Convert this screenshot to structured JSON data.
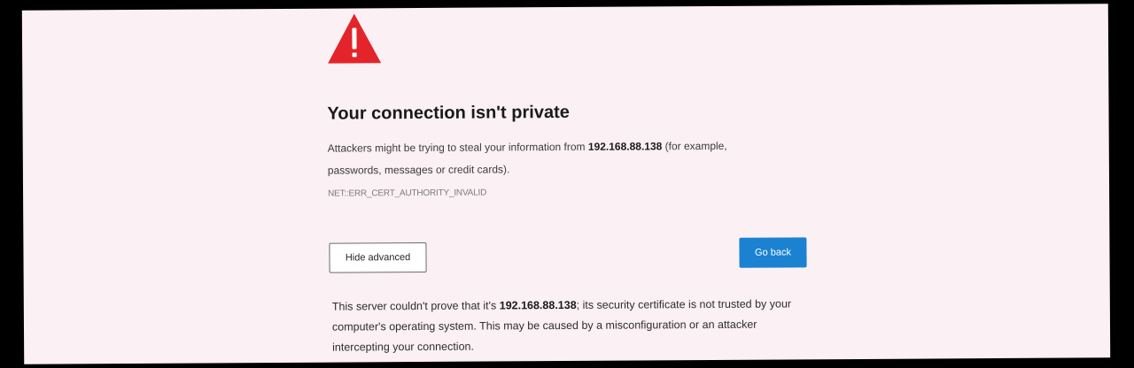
{
  "page": {
    "icon": "warning-triangle-icon",
    "accent_color": "#e3242b",
    "title": "Your connection isn't private",
    "description": {
      "before": "Attackers might be trying to steal your information from ",
      "host": "192.168.88.138",
      "after": " (for example, passwords, messages or credit cards)."
    },
    "error_code": "NET::ERR_CERT_AUTHORITY_INVALID",
    "hide_advanced_label": "Hide advanced",
    "go_back_label": "Go back",
    "go_back_color": "#1a82d1",
    "advanced": {
      "before": "This server couldn't prove that it's ",
      "host": "192.168.88.138",
      "after": "; its security certificate is not trusted by your computer's operating system. This may be caused by a misconfiguration or an attacker intercepting your connection."
    }
  }
}
